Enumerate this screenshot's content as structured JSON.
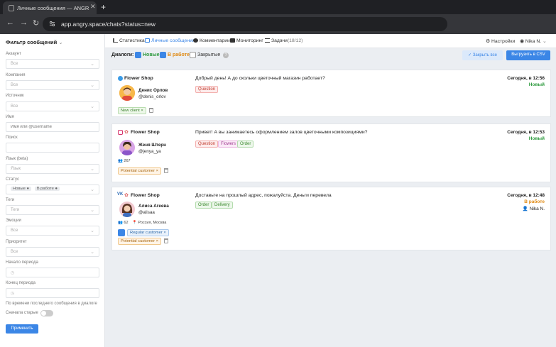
{
  "browser": {
    "tab_title": "Личные сообщения — ANGR",
    "url": "app.angry.space/chats?status=new"
  },
  "menu": {
    "items": [
      {
        "label": "Статистика",
        "icon": "chart-icon"
      },
      {
        "label": "Личные сообщения",
        "icon": "message-icon",
        "active": true
      },
      {
        "label": "Комментарии",
        "icon": "comment-icon"
      },
      {
        "label": "Мониторинг",
        "icon": "monitor-icon"
      },
      {
        "label": "Задачи",
        "icon": "tasks-icon",
        "count": "(18/12)"
      }
    ],
    "settings": "Настройки",
    "user": "Nika N."
  },
  "filters": {
    "title": "Фильтр сообщений",
    "fields": [
      {
        "label": "Аккаунт",
        "value": "Все"
      },
      {
        "label": "Компания",
        "value": "Все"
      },
      {
        "label": "Источник",
        "value": "Все"
      },
      {
        "label": "Имя",
        "placeholder": "Имя или @username"
      },
      {
        "label": "Поиск",
        "value": ""
      },
      {
        "label": "Язык (beta)",
        "value": "Язык"
      },
      {
        "label": "Статус",
        "chips": [
          "Новые",
          "В работе"
        ]
      },
      {
        "label": "Теги",
        "value": "Теги"
      },
      {
        "label": "Эмоции",
        "value": "Все"
      },
      {
        "label": "Приоритет",
        "value": "Все"
      },
      {
        "label": "Начало периода",
        "value": ""
      },
      {
        "label": "Конец периода",
        "value": ""
      }
    ],
    "period_note": "По времени последнего сообщения в диалоге",
    "old_first": "Сначала старые",
    "apply": "Применить"
  },
  "dialogs": {
    "title": "Диалоги:",
    "statuses": [
      {
        "label": "Новые",
        "checked": true,
        "color": "#2e9a3f"
      },
      {
        "label": "В работе",
        "checked": true,
        "color": "#e08a13"
      },
      {
        "label": "Закрытые",
        "checked": false,
        "color": "#333333"
      }
    ],
    "help": "?",
    "close_all": "Закрыть все",
    "export_csv": "Выгрузить в CSV"
  },
  "chats": [
    {
      "shop": "Flower Shop",
      "source_icon": "telegram-icon",
      "name": "Денис Орлов",
      "handle": "@denis_orlov",
      "message": "Добрый день! А до скольки цветочный магазин работает?",
      "tags": [
        "Question"
      ],
      "customer_tags": [
        "New client"
      ],
      "time": "Сегодня, в 12:56",
      "status": "Новый",
      "status_color": "#2e9a3f"
    },
    {
      "shop": "Flower Shop",
      "source_icon": "instagram-icon",
      "name": "Женя Штерн",
      "handle": "@jenya_ya",
      "followers": "267",
      "message": "Привет! А вы занимаетесь оформлением залов цветочными композициями?",
      "tags": [
        "Question",
        "Flowers",
        "Order"
      ],
      "customer_tags": [
        "Potential customer"
      ],
      "time": "Сегодня, в 12:53",
      "status": "Новый",
      "status_color": "#2e9a3f"
    },
    {
      "shop": "Flower Shop",
      "source_icon": "vk-icon",
      "name": "Алиса Агеева",
      "handle": "@alisaa",
      "followers": "62",
      "location": "Россия, Москва",
      "message": "Доставьте на прошлый адрес, пожалуйста. Деньги перевела",
      "tags": [
        "Order",
        "Delivery"
      ],
      "customer_tags": [
        "Regular customer",
        "Potential customer"
      ],
      "time": "Сегодня, в 12:48",
      "status": "В работе",
      "status_color": "#e08a13",
      "assignee": "Nika N."
    }
  ]
}
